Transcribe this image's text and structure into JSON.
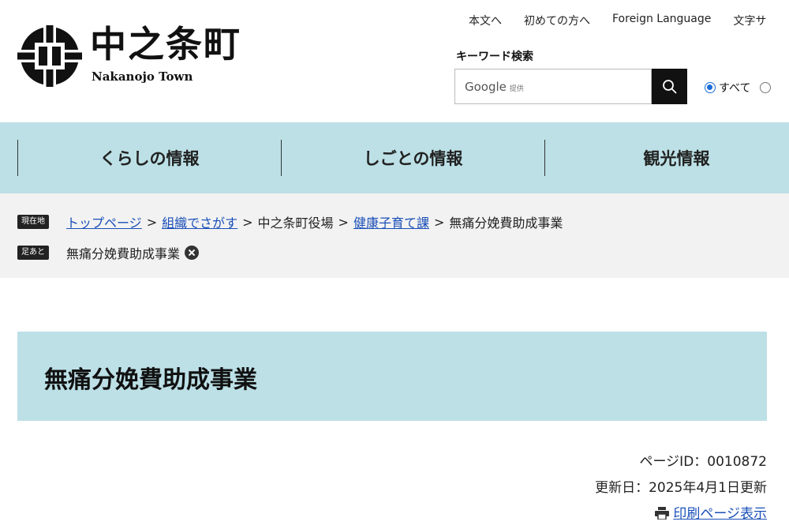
{
  "header": {
    "logo_title": "中之条町",
    "logo_sub": "Nakanojo Town",
    "util_links": [
      "本文へ",
      "初めての方へ",
      "Foreign Language",
      "文字サ"
    ],
    "keyword_label": "キーワード検索",
    "search_google": "Google",
    "search_provided": "提供",
    "radio_all": "すべて"
  },
  "gnav": {
    "items": [
      "くらしの情報",
      "しごとの情報",
      "観光情報"
    ]
  },
  "breadcrumb": {
    "current_tag": "現在地",
    "items": [
      "トップページ",
      "組織でさがす",
      "中之条町役場",
      "健康子育て課",
      "無痛分娩費助成事業"
    ],
    "sep": ">",
    "history_tag": "足あと",
    "history_item": "無痛分娩費助成事業"
  },
  "page": {
    "title": "無痛分娩費助成事業",
    "page_id": "ページID：0010872",
    "updated": "更新日：2025年4月1日更新",
    "print_label": "印刷ページ表示"
  }
}
